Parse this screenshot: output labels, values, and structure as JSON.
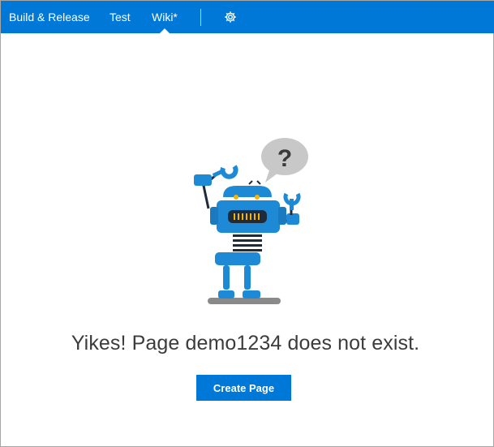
{
  "nav": {
    "items": [
      {
        "label": "Build & Release"
      },
      {
        "label": "Test"
      },
      {
        "label": "Wiki*"
      }
    ],
    "settings_icon": "gear-icon"
  },
  "illustration": {
    "icon": "robot-confused-icon",
    "speech_bubble_text": "?"
  },
  "main": {
    "message": "Yikes! Page demo1234 does not exist.",
    "create_button_label": "Create Page"
  },
  "colors": {
    "accent": "#0078d7",
    "robot_blue": "#1e8ad6",
    "robot_dark": "#1f2b3a",
    "bubble": "#c8c8c8",
    "eyes": "#f5b400"
  }
}
